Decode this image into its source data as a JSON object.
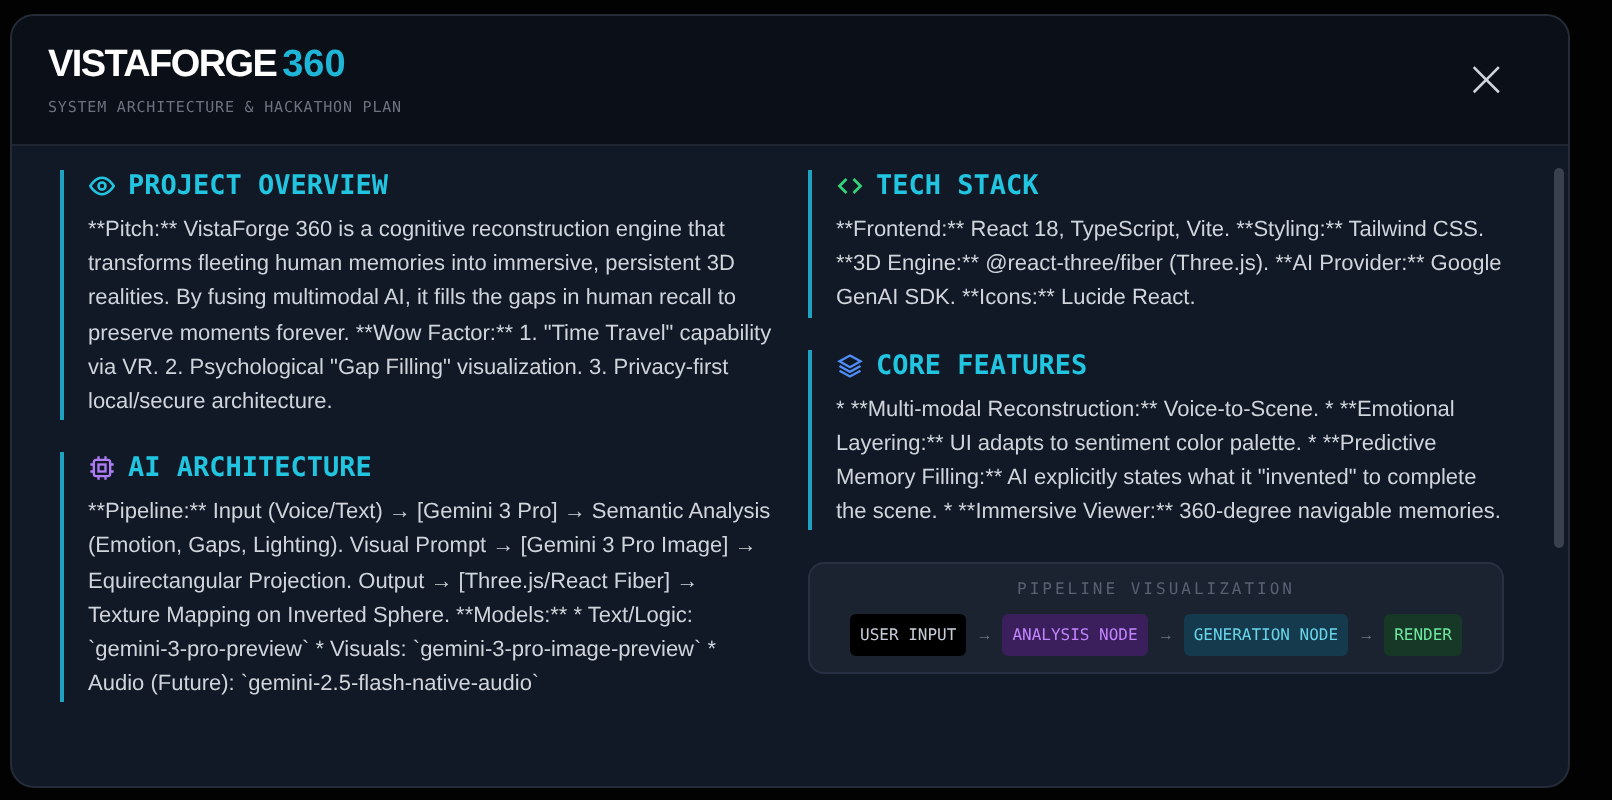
{
  "dialog": {
    "title": "VISTAFORGE",
    "title_accent": "360",
    "subtitle": "SYSTEM ARCHITECTURE & HACKATHON PLAN",
    "close": "×"
  },
  "left_column": [
    {
      "heading": "PROJECT OVERVIEW",
      "text": "**Pitch:** VistaForge 360 is a cognitive reconstruction engine that transforms fleeting human memories into immersive, persistent 3D realities. By fusing multimodal AI, it fills the gaps in human recall to preserve moments forever. **Wow Factor:** 1. \"Time Travel\" capability via VR. 2. Psychological \"Gap Filling\" visualization. 3. Privacy-first local/secure architecture."
    },
    {
      "heading": "AI ARCHITECTURE",
      "text": "**Pipeline:** Input (Voice/Text) → [Gemini 3 Pro] → Semantic Analysis (Emotion, Gaps, Lighting). Visual Prompt → [Gemini 3 Pro Image] → Equirectangular Projection. Output → [Three.js/React Fiber] → Texture Mapping on Inverted Sphere. **Models:** * Text/Logic: `gemini-3-pro-preview` * Visuals: `gemini-3-pro-image-preview` * Audio (Future): `gemini-2.5-flash-native-audio`"
    }
  ],
  "right_column": [
    {
      "heading": "TECH STACK",
      "text": "**Frontend:** React 18, TypeScript, Vite. **Styling:** Tailwind CSS. **3D Engine:** @react-three/fiber (Three.js). **AI Provider:** Google GenAI SDK. **Icons:** Lucide React."
    },
    {
      "heading": "CORE FEATURES",
      "text": "* **Multi-modal Reconstruction:** Voice-to-Scene. * **Emotional Layering:** UI adapts to sentiment color palette. * **Predictive Memory Filling:** AI explicitly states what it \"invented\" to complete the scene. * **Immersive Viewer:** 360-degree navigable memories."
    }
  ],
  "pipeline": {
    "title": "PIPELINE VISUALIZATION",
    "nodes": [
      {
        "label": "USER INPUT",
        "color": "#000000",
        "arrow": "→"
      },
      {
        "label": "ANALYSIS NODE",
        "color": "#3b1f5c",
        "arrow": "→"
      },
      {
        "label": "GENERATION NODE",
        "color": "#163a4d",
        "arrow": "→"
      },
      {
        "label": "RENDER",
        "color": "#173826"
      }
    ]
  }
}
